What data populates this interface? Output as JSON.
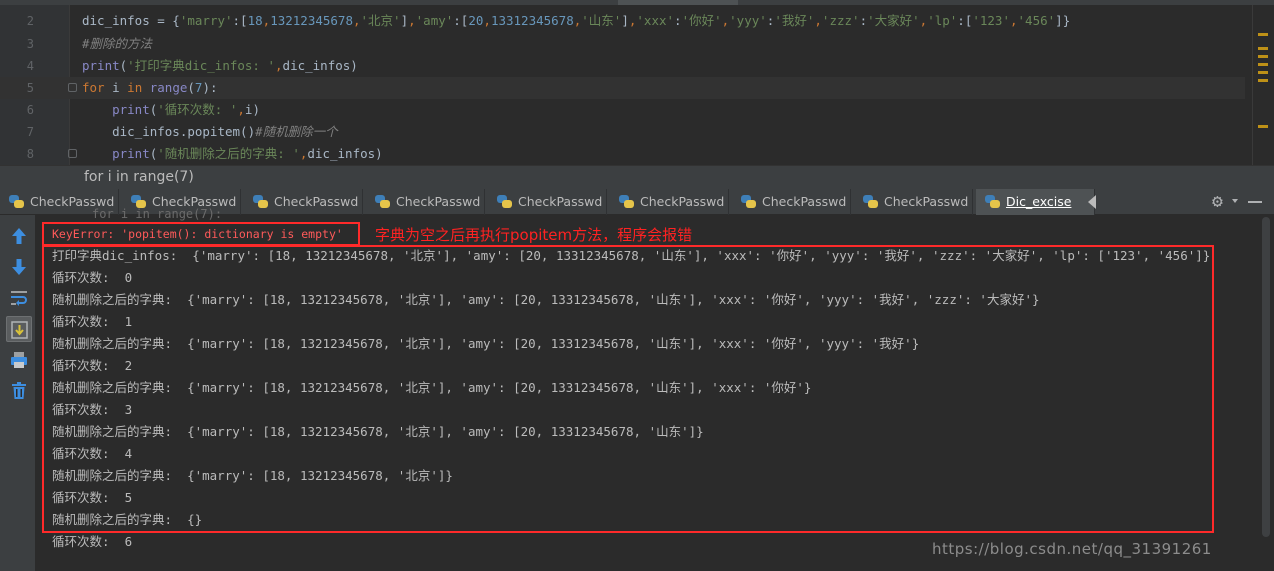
{
  "editor": {
    "lines": [
      {
        "number": "2",
        "tokens": [
          {
            "t": "dic_infos = {",
            "c": ""
          },
          {
            "t": "'marry'",
            "c": "str"
          },
          {
            "t": ":[",
            "c": ""
          },
          {
            "t": "18",
            "c": "num"
          },
          {
            "t": ",",
            "c": "kw"
          },
          {
            "t": "13212345678",
            "c": "num"
          },
          {
            "t": ",",
            "c": "kw"
          },
          {
            "t": "'北京'",
            "c": "str"
          },
          {
            "t": "]",
            "c": ""
          },
          {
            "t": ",",
            "c": "kw"
          },
          {
            "t": "'amy'",
            "c": "str"
          },
          {
            "t": ":[",
            "c": ""
          },
          {
            "t": "20",
            "c": "num"
          },
          {
            "t": ",",
            "c": "kw"
          },
          {
            "t": "13312345678",
            "c": "num"
          },
          {
            "t": ",",
            "c": "kw"
          },
          {
            "t": "'山东'",
            "c": "str"
          },
          {
            "t": "]",
            "c": ""
          },
          {
            "t": ",",
            "c": "kw"
          },
          {
            "t": "'xxx'",
            "c": "str"
          },
          {
            "t": ":",
            "c": ""
          },
          {
            "t": "'你好'",
            "c": "str"
          },
          {
            "t": ",",
            "c": "kw"
          },
          {
            "t": "'yyy'",
            "c": "str"
          },
          {
            "t": ":",
            "c": ""
          },
          {
            "t": "'我好'",
            "c": "str"
          },
          {
            "t": ",",
            "c": "kw"
          },
          {
            "t": "'zzz'",
            "c": "str"
          },
          {
            "t": ":",
            "c": ""
          },
          {
            "t": "'大家好'",
            "c": "str"
          },
          {
            "t": ",",
            "c": "kw"
          },
          {
            "t": "'lp'",
            "c": "str"
          },
          {
            "t": ":[",
            "c": ""
          },
          {
            "t": "'123'",
            "c": "str"
          },
          {
            "t": ",",
            "c": "kw"
          },
          {
            "t": "'456'",
            "c": "str"
          },
          {
            "t": "]}",
            "c": ""
          }
        ]
      },
      {
        "number": "3",
        "tokens": [
          {
            "t": "#删除的方法",
            "c": "cm"
          }
        ]
      },
      {
        "number": "4",
        "tokens": [
          {
            "t": "print",
            "c": "fn"
          },
          {
            "t": "(",
            "c": ""
          },
          {
            "t": "'打印字典dic_infos: '",
            "c": "str"
          },
          {
            "t": ",",
            "c": "kw"
          },
          {
            "t": "dic_infos)",
            "c": ""
          }
        ]
      },
      {
        "number": "5",
        "tokens": [
          {
            "t": "for ",
            "c": "kw"
          },
          {
            "t": "i ",
            "c": ""
          },
          {
            "t": "in ",
            "c": "kw"
          },
          {
            "t": "range",
            "c": "fn"
          },
          {
            "t": "(",
            "c": ""
          },
          {
            "t": "7",
            "c": "num"
          },
          {
            "t": "):",
            "c": ""
          }
        ]
      },
      {
        "number": "6",
        "tokens": [
          {
            "t": "    ",
            "c": ""
          },
          {
            "t": "print",
            "c": "fn"
          },
          {
            "t": "(",
            "c": ""
          },
          {
            "t": "'循环次数: '",
            "c": "str"
          },
          {
            "t": ",",
            "c": "kw"
          },
          {
            "t": "i)",
            "c": ""
          }
        ]
      },
      {
        "number": "7",
        "tokens": [
          {
            "t": "    dic_infos.popitem()",
            "c": ""
          },
          {
            "t": "#随机删除一个",
            "c": "cm"
          }
        ]
      },
      {
        "number": "8",
        "tokens": [
          {
            "t": "    ",
            "c": ""
          },
          {
            "t": "print",
            "c": "fn"
          },
          {
            "t": "(",
            "c": ""
          },
          {
            "t": "'随机删除之后的字典: '",
            "c": "str"
          },
          {
            "t": ",",
            "c": "kw"
          },
          {
            "t": "dic_infos)",
            "c": ""
          }
        ]
      }
    ]
  },
  "breadcrumb": {
    "text": "for i in range(7)"
  },
  "run_tabs": [
    {
      "label": "CheckPasswd"
    },
    {
      "label": "CheckPasswd"
    },
    {
      "label": "CheckPasswd"
    },
    {
      "label": "CheckPasswd"
    },
    {
      "label": "CheckPasswd"
    },
    {
      "label": "CheckPasswd"
    },
    {
      "label": "CheckPasswd"
    },
    {
      "label": "CheckPasswd"
    },
    {
      "label": "Dic_excise",
      "active": true
    }
  ],
  "console": {
    "ghost": "for i in range(7):",
    "error": "KeyError: 'popitem(): dictionary is empty'",
    "annotation": "字典为空之后再执行popitem方法，程序会报错",
    "lines": [
      "打印字典dic_infos:  {'marry': [18, 13212345678, '北京'], 'amy': [20, 13312345678, '山东'], 'xxx': '你好', 'yyy': '我好', 'zzz': '大家好', 'lp': ['123', '456']}",
      "循环次数:  0",
      "随机删除之后的字典:  {'marry': [18, 13212345678, '北京'], 'amy': [20, 13312345678, '山东'], 'xxx': '你好', 'yyy': '我好', 'zzz': '大家好'}",
      "循环次数:  1",
      "随机删除之后的字典:  {'marry': [18, 13212345678, '北京'], 'amy': [20, 13312345678, '山东'], 'xxx': '你好', 'yyy': '我好'}",
      "循环次数:  2",
      "随机删除之后的字典:  {'marry': [18, 13212345678, '北京'], 'amy': [20, 13312345678, '山东'], 'xxx': '你好'}",
      "循环次数:  3",
      "随机删除之后的字典:  {'marry': [18, 13212345678, '北京'], 'amy': [20, 13312345678, '山东']}",
      "循环次数:  4",
      "随机删除之后的字典:  {'marry': [18, 13212345678, '北京']}",
      "循环次数:  5",
      "随机删除之后的字典:  {}",
      "循环次数:  6"
    ]
  },
  "watermark": "https://blog.csdn.net/qq_31391261",
  "colors": {
    "annotation_red": "#ff2a2a",
    "keyword": "#cc7832",
    "string": "#6a8759",
    "number": "#6897bb",
    "comment": "#808080",
    "builtin": "#8888c6"
  },
  "icons": {
    "toolbar": [
      "arrow-up-icon",
      "arrow-down-icon",
      "soft-wrap-icon",
      "scroll-to-end-icon",
      "print-icon",
      "trash-icon"
    ],
    "tabs": "python-file-icon",
    "settings": "gear-icon"
  }
}
